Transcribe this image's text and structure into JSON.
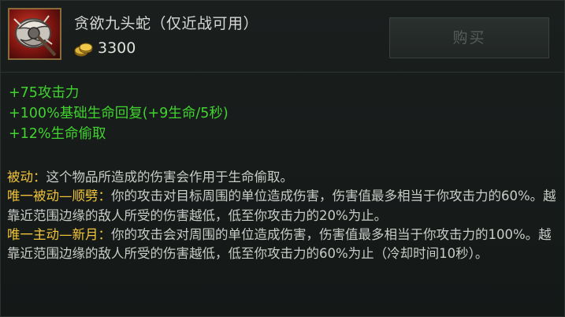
{
  "item": {
    "name": "贪欲九头蛇（仅近战可用）",
    "price": "3300",
    "icon": "hydra-axe-icon",
    "buy_label": "购买"
  },
  "stats": [
    "+75攻击力",
    "+100%基础生命回复(+9生命/5秒)",
    "+12%生命偷取"
  ],
  "passive": {
    "label": "被动：",
    "text": "这个物品所造成的伤害会作用于生命偷取。"
  },
  "unique_passive": {
    "label": "唯一被动—顺劈：",
    "text": "你的攻击对目标周围的单位造成伤害，伤害值最多相当于你攻击力的60%。越靠近范围边缘的敌人所受的伤害越低，低至你攻击力的20%为止。"
  },
  "unique_active": {
    "label": "唯一主动—新月：",
    "text": "你的攻击会对周围的单位造成伤害，伤害值最多相当于你攻击力的100%。越靠近范围边缘的敌人所受的伤害越低，低至你攻击力的60%为止（冷却时间10秒）。"
  },
  "colors": {
    "stat": "#41d42f",
    "highlight": "#f2c53a",
    "text": "#c9cbc6",
    "background": "#161a19"
  }
}
